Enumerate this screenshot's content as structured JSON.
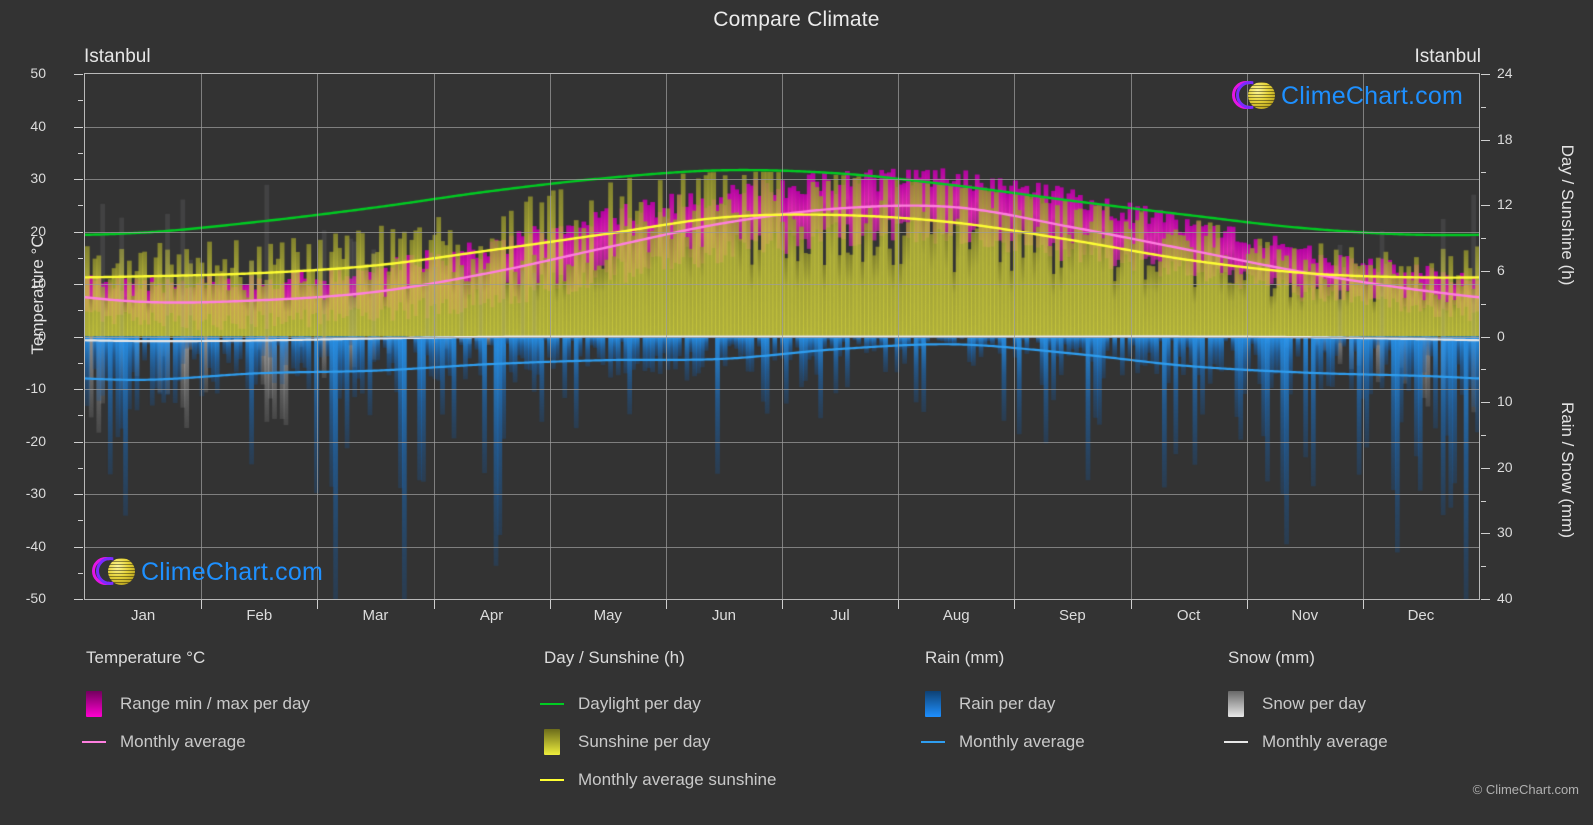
{
  "header": {
    "title": "Compare Climate"
  },
  "city_left_label": "Istanbul",
  "city_right_label": "Istanbul",
  "axes": {
    "left_title": "Temperature °C",
    "right_title_top": "Day / Sunshine (h)",
    "right_title_bottom": "Rain / Snow (mm)",
    "left_ticks": [
      "50",
      "40",
      "30",
      "20",
      "10",
      "0",
      "-10",
      "-20",
      "-30",
      "-40",
      "-50"
    ],
    "right_ticks_top": [
      "24",
      "18",
      "12",
      "6",
      "0"
    ],
    "right_ticks_bottom": [
      "10",
      "20",
      "30",
      "40"
    ],
    "months": [
      "Jan",
      "Feb",
      "Mar",
      "Apr",
      "May",
      "Jun",
      "Jul",
      "Aug",
      "Sep",
      "Oct",
      "Nov",
      "Dec"
    ]
  },
  "legend": {
    "temperature": {
      "heading": "Temperature °C",
      "items": [
        {
          "label": "Range min / max per day",
          "marker": "swatch",
          "color": "#ff00d0"
        },
        {
          "label": "Monthly average",
          "marker": "line",
          "color": "#ff7fe0"
        }
      ]
    },
    "daylight": {
      "heading": "Day / Sunshine (h)",
      "items": [
        {
          "label": "Daylight per day",
          "marker": "line",
          "color": "#00cc22"
        },
        {
          "label": "Sunshine per day",
          "marker": "swatch",
          "color": "#eded3c"
        },
        {
          "label": "Monthly average sunshine",
          "marker": "line",
          "color": "#ffff33"
        }
      ]
    },
    "rain": {
      "heading": "Rain (mm)",
      "items": [
        {
          "label": "Rain per day",
          "marker": "swatch",
          "color": "#1e90ff"
        },
        {
          "label": "Monthly average",
          "marker": "line",
          "color": "#2f9ef0"
        }
      ]
    },
    "snow": {
      "heading": "Snow (mm)",
      "items": [
        {
          "label": "Snow per day",
          "marker": "swatch",
          "color": "#e8e8e8"
        },
        {
          "label": "Monthly average",
          "marker": "line",
          "color": "#e8e8e8"
        }
      ]
    }
  },
  "watermark": {
    "text": "ClimeChart.com",
    "copyright": "© ClimeChart.com"
  },
  "colors": {
    "background": "#333333",
    "grid": "#9c9c9c",
    "daylight_line": "#00cc22",
    "sunshine_line": "#ffff33",
    "temp_avg_line": "#ff7fe0",
    "temp_range_fill": "#ff00d0",
    "sunshine_fill": "#c8c83c",
    "rain_fill": "#1e90ff",
    "rain_avg_line": "#2f9ef0",
    "snow_line": "#e8e8e8",
    "text": "#d8d8d8"
  },
  "chart_data": {
    "type": "line",
    "title": "Compare Climate",
    "subtitle": "Istanbul",
    "xlabel": "",
    "ylabel": "Temperature °C",
    "ylabel_right_top": "Day / Sunshine (h)",
    "ylabel_right_bottom": "Rain / Snow (mm)",
    "ylim": [
      -50,
      50
    ],
    "ylim_right_top": [
      0,
      24
    ],
    "ylim_right_bottom": [
      0,
      40
    ],
    "grid": true,
    "legend_position": "bottom",
    "categories": [
      "Jan",
      "Feb",
      "Mar",
      "Apr",
      "May",
      "Jun",
      "Jul",
      "Aug",
      "Sep",
      "Oct",
      "Nov",
      "Dec"
    ],
    "series": [
      {
        "name": "Daylight per day",
        "unit": "h",
        "axis": "right-top",
        "color": "#00cc22",
        "values": [
          9.5,
          10.5,
          11.8,
          13.3,
          14.5,
          15.2,
          14.9,
          13.8,
          12.4,
          11.1,
          9.9,
          9.3
        ]
      },
      {
        "name": "Monthly average sunshine",
        "unit": "h",
        "axis": "right-top",
        "color": "#ffff33",
        "values": [
          5.5,
          5.8,
          6.5,
          7.9,
          9.4,
          10.9,
          11.1,
          10.4,
          8.8,
          7.0,
          5.8,
          5.4
        ]
      },
      {
        "name": "Monthly average temperature",
        "unit": "°C",
        "axis": "left",
        "color": "#ff7fe0",
        "values": [
          6.6,
          6.9,
          8.5,
          12.2,
          17.0,
          21.6,
          24.4,
          24.6,
          20.8,
          16.5,
          12.2,
          8.8
        ]
      },
      {
        "name": "Range max per day",
        "unit": "°C",
        "axis": "left",
        "color": "#ff00d0",
        "values": [
          9.5,
          10.0,
          12.2,
          16.6,
          21.6,
          26.3,
          28.8,
          29.0,
          25.2,
          20.4,
          15.6,
          11.7
        ]
      },
      {
        "name": "Range min per day",
        "unit": "°C",
        "axis": "left",
        "color": "#ff00d0",
        "values": [
          3.6,
          3.6,
          5.0,
          8.4,
          12.8,
          17.2,
          20.2,
          20.4,
          16.8,
          13.0,
          8.9,
          5.9
        ]
      },
      {
        "name": "Rain monthly average",
        "unit": "mm",
        "axis": "right-bottom",
        "color": "#2f9ef0",
        "values": [
          6.6,
          5.6,
          5.2,
          4.2,
          3.6,
          3.4,
          1.9,
          1.2,
          2.6,
          4.5,
          5.5,
          6.0
        ]
      },
      {
        "name": "Snow monthly average",
        "unit": "mm",
        "axis": "right-bottom",
        "color": "#e8e8e8",
        "values": [
          0.7,
          0.6,
          0.3,
          0.05,
          0,
          0,
          0,
          0,
          0,
          0,
          0.1,
          0.4
        ]
      }
    ]
  }
}
